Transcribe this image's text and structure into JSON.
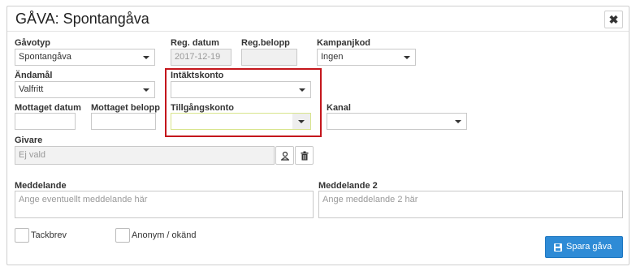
{
  "dialog": {
    "title": "GÅVA: Spontangåva",
    "close_glyph": "✖"
  },
  "fields": {
    "gavotyp": {
      "label": "Gåvotyp",
      "value": "Spontangåva"
    },
    "reg_datum": {
      "label": "Reg. datum",
      "value": "2017-12-19"
    },
    "reg_belopp": {
      "label": "Reg.belopp",
      "value": ""
    },
    "kampanjkod": {
      "label": "Kampanjkod",
      "value": "Ingen"
    },
    "andamal": {
      "label": "Ändamål",
      "value": "Valfritt"
    },
    "intaktskonto": {
      "label": "Intäktskonto",
      "value": ""
    },
    "mottaget_datum": {
      "label": "Mottaget datum",
      "value": ""
    },
    "mottaget_belopp": {
      "label": "Mottaget belopp",
      "value": ""
    },
    "tillgangskonto": {
      "label": "Tillgångskonto",
      "value": ""
    },
    "kanal": {
      "label": "Kanal",
      "value": ""
    },
    "givare": {
      "label": "Givare",
      "value": "Ej vald"
    },
    "meddelande": {
      "label": "Meddelande",
      "placeholder": "Ange eventuellt meddelande här"
    },
    "meddelande2": {
      "label": "Meddelande 2",
      "placeholder": "Ange meddelande 2 här"
    }
  },
  "checkboxes": {
    "tackbrev": {
      "label": "Tackbrev",
      "checked": false
    },
    "anonym": {
      "label": "Anonym / okänd",
      "checked": false
    }
  },
  "actions": {
    "save_label": "Spara gåva"
  },
  "icons": {
    "close": "close-icon",
    "select_user": "user-select-icon",
    "delete": "trash-icon",
    "save": "save-icon",
    "dropdown": "caret-down-icon"
  },
  "colors": {
    "highlight": "#c4161c",
    "primary_button": "#2e8bd6",
    "focus_border": "#d8e48c"
  }
}
